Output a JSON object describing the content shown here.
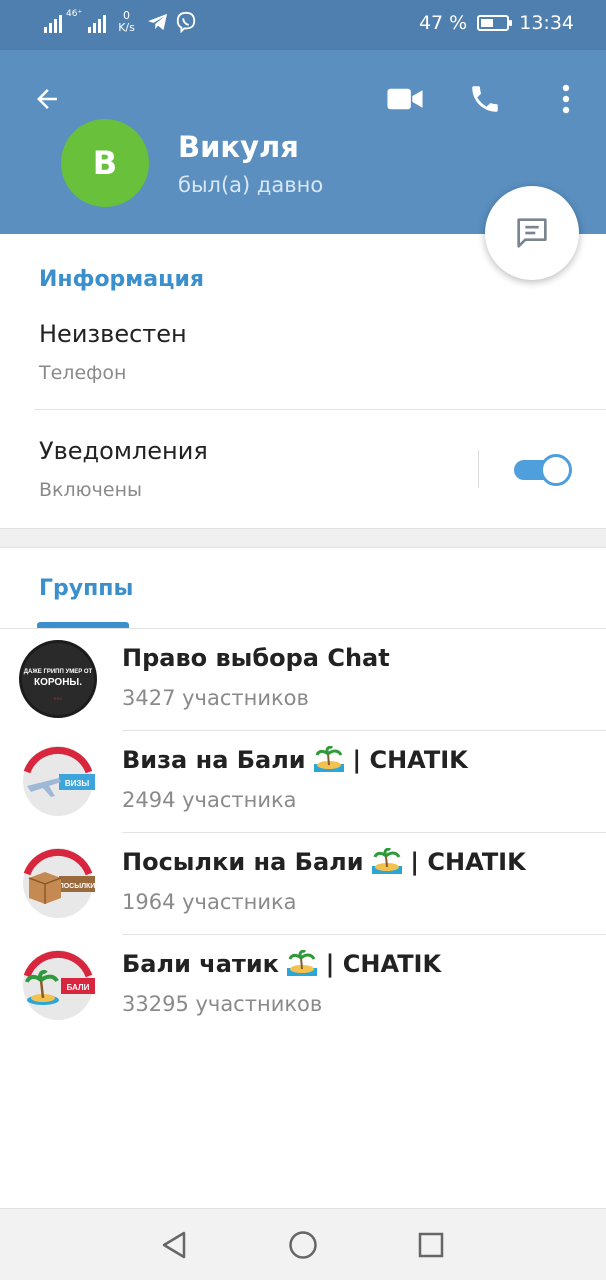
{
  "status_bar": {
    "network_label": "46⁺",
    "speed_value": "0",
    "speed_unit": "K/s",
    "battery_percent": "47 %",
    "battery_level": 0.47,
    "time": "13:34",
    "icons": [
      "telegram-icon",
      "viber-icon"
    ]
  },
  "header": {
    "back_icon": "arrow-left-icon",
    "actions": [
      "video-call-icon",
      "phone-icon",
      "more-vert-icon"
    ],
    "avatar_letter": "В",
    "avatar_color": "#68c03b",
    "name": "Викуля",
    "status": "был(а) давно",
    "color": "#5a8fc0"
  },
  "info": {
    "title": "Информация",
    "phone_value": "Неизвестен",
    "phone_label": "Телефон",
    "notifications_label": "Уведомления",
    "notifications_value": "Включены",
    "notifications_enabled": true
  },
  "groups": {
    "title": "Группы",
    "items": [
      {
        "name": "Право выбора Chat",
        "count": "3427 участников",
        "avatar_text": "ДАЖЕ ГРИПП УМЕР ОТ КОРОНЫ.",
        "avatar_style": "dark"
      },
      {
        "name": "Виза на Бали",
        "suffix": "| CHATIK",
        "count": "2494 участника",
        "avatar_text": "ВИЗЫ",
        "avatar_style": "plane"
      },
      {
        "name": "Посылки на Бали",
        "suffix": "| CHATIK",
        "count": "1964 участника",
        "avatar_text": "ПОСЫЛКИ",
        "avatar_style": "box"
      },
      {
        "name": "Бали чатик",
        "suffix": "| CHATIK",
        "count": "33295 участников",
        "avatar_text": "БАЛИ",
        "avatar_style": "island"
      }
    ]
  },
  "accent_color": "#3a8fcc",
  "navbar": [
    "back-triangle-icon",
    "home-circle-icon",
    "recents-square-icon"
  ]
}
